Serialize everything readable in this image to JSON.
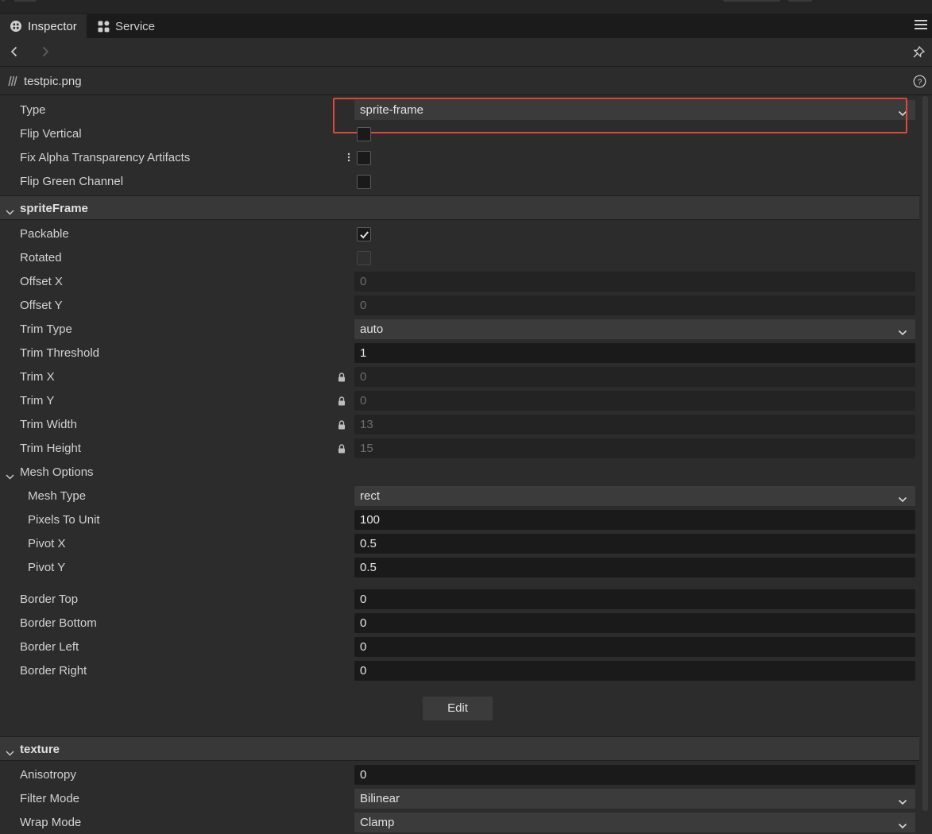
{
  "tabs": [
    {
      "label": "Inspector",
      "icon": "inspector-icon"
    },
    {
      "label": "Service",
      "icon": "grid-icon"
    }
  ],
  "asset": {
    "name": "testpic.png",
    "icon": "image-file-icon"
  },
  "properties": {
    "type": {
      "label": "Type",
      "value": "sprite-frame"
    },
    "flip_vertical": {
      "label": "Flip Vertical",
      "checked": false
    },
    "fix_alpha": {
      "label": "Fix Alpha Transparency Artifacts",
      "checked": false
    },
    "flip_green": {
      "label": "Flip Green Channel",
      "checked": false
    }
  },
  "sprite_frame": {
    "title": "spriteFrame",
    "packable": {
      "label": "Packable",
      "checked": true
    },
    "rotated": {
      "label": "Rotated",
      "checked": false
    },
    "offset_x": {
      "label": "Offset X",
      "value": "0"
    },
    "offset_y": {
      "label": "Offset Y",
      "value": "0"
    },
    "trim_type": {
      "label": "Trim Type",
      "value": "auto"
    },
    "trim_threshold": {
      "label": "Trim Threshold",
      "value": "1"
    },
    "trim_x": {
      "label": "Trim X",
      "value": "0"
    },
    "trim_y": {
      "label": "Trim Y",
      "value": "0"
    },
    "trim_width": {
      "label": "Trim Width",
      "value": "13"
    },
    "trim_height": {
      "label": "Trim Height",
      "value": "15"
    },
    "mesh_options": {
      "title": "Mesh Options",
      "mesh_type": {
        "label": "Mesh Type",
        "value": "rect"
      },
      "pixels_to_unit": {
        "label": "Pixels To Unit",
        "value": "100"
      },
      "pivot_x": {
        "label": "Pivot X",
        "value": "0.5"
      },
      "pivot_y": {
        "label": "Pivot Y",
        "value": "0.5"
      }
    },
    "border_top": {
      "label": "Border Top",
      "value": "0"
    },
    "border_bottom": {
      "label": "Border Bottom",
      "value": "0"
    },
    "border_left": {
      "label": "Border Left",
      "value": "0"
    },
    "border_right": {
      "label": "Border Right",
      "value": "0"
    },
    "edit_label": "Edit"
  },
  "texture": {
    "title": "texture",
    "anisotropy": {
      "label": "Anisotropy",
      "value": "0"
    },
    "filter_mode": {
      "label": "Filter Mode",
      "value": "Bilinear"
    },
    "wrap_mode": {
      "label": "Wrap Mode",
      "value": "Clamp"
    }
  },
  "colors": {
    "panel_bg": "#2c2c2c",
    "tabbar_bg": "#1b1b1b",
    "section_bg": "#383838",
    "input_bg": "#1a1a1a",
    "select_bg": "#3b3b3b",
    "highlight": "#e0483e"
  }
}
